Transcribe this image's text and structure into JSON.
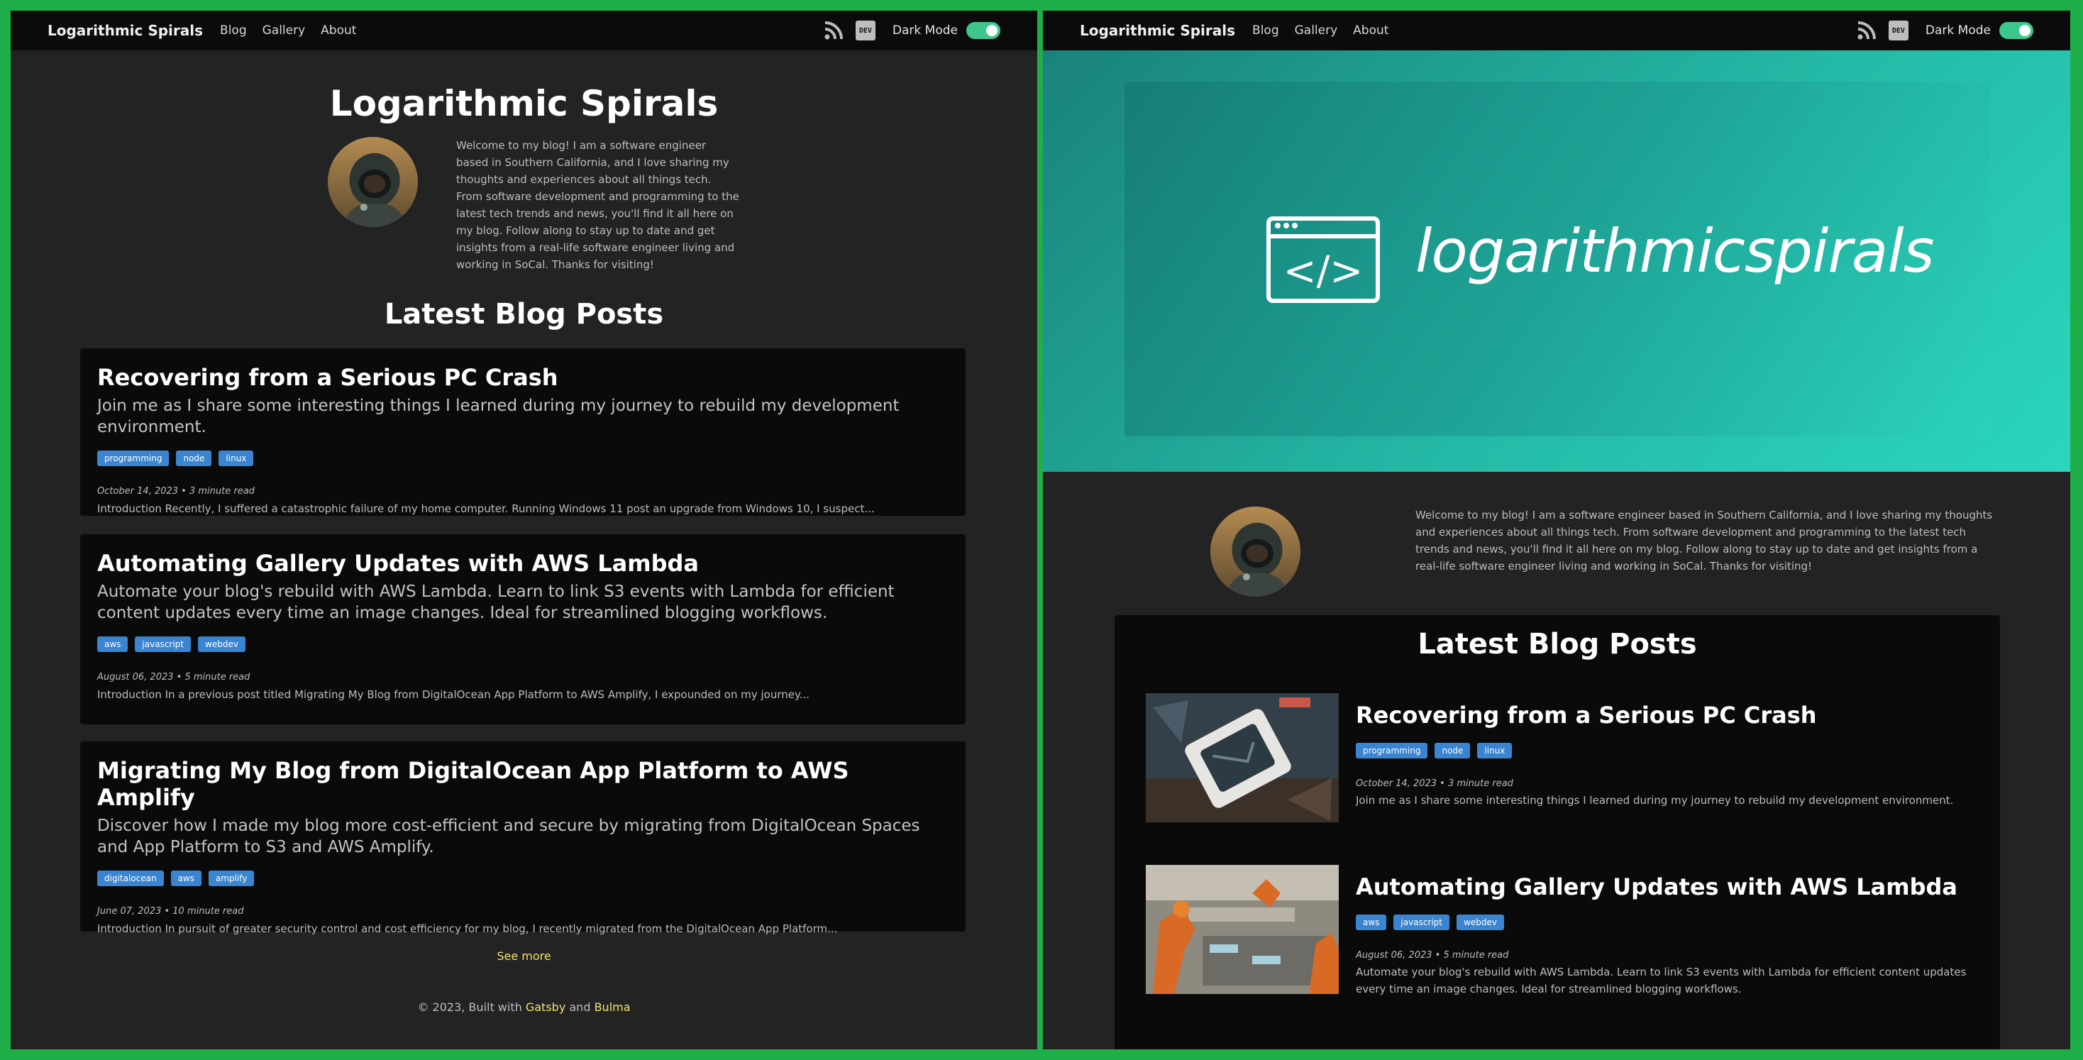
{
  "nav": {
    "brand": "Logarithmic Spirals",
    "links": [
      "Blog",
      "Gallery",
      "About"
    ],
    "dev_label": "DEV",
    "dark_mode_label": "Dark Mode",
    "dark_mode_on": true
  },
  "site_title": "Logarithmic Spirals",
  "intro": "Welcome to my blog! I am a software engineer based in Southern California, and I love sharing my thoughts and experiences about all things tech. From software development and programming to the latest tech trends and news, you'll find it all here on my blog. Follow along to stay up to date and get insights from a real-life software engineer living and working in SoCal. Thanks for visiting!",
  "latest_title": "Latest Blog Posts",
  "posts": [
    {
      "title": "Recovering from a Serious PC Crash",
      "description": "Join me as I share some interesting things I learned during my journey to rebuild my development environment.",
      "tags": [
        "programming",
        "node",
        "linux"
      ],
      "meta": "October 14, 2023 • 3 minute read",
      "excerpt": "Introduction Recently, I suffered a catastrophic failure of my home computer. Running Windows 11 post an upgrade from Windows 10, I suspect..."
    },
    {
      "title": "Automating Gallery Updates with AWS Lambda",
      "description": "Automate your blog's rebuild with AWS Lambda. Learn to link S3 events with Lambda for efficient content updates every time an image changes. Ideal for streamlined blogging workflows.",
      "tags": [
        "aws",
        "javascript",
        "webdev"
      ],
      "meta": "August 06, 2023 • 5 minute read",
      "excerpt": "Introduction In a previous post titled Migrating My Blog from DigitalOcean App Platform to AWS Amplify, I expounded on my journey..."
    },
    {
      "title": "Migrating My Blog from DigitalOcean App Platform to AWS Amplify",
      "description": "Discover how I made my blog more cost-efficient and secure by migrating from DigitalOcean Spaces and App Platform to S3 and AWS Amplify.",
      "tags": [
        "digitalocean",
        "aws",
        "amplify"
      ],
      "meta": "June 07, 2023 • 10 minute read",
      "excerpt": "Introduction In pursuit of greater security control and cost efficiency for my blog, I recently migrated from the DigitalOcean App Platform..."
    }
  ],
  "see_more": "See more",
  "footer": {
    "prefix": "© 2023, Built with",
    "gatsby": "Gatsby",
    "and": "and",
    "bulma": "Bulma"
  },
  "hero": {
    "logo_text": "logarithmicspirals",
    "code_glyph": "</>"
  },
  "colors": {
    "accent_yellow": "#f2e56b",
    "tag_blue": "#3a85d1",
    "toggle_green": "#3ec78d",
    "frame_green": "#1fae47"
  }
}
